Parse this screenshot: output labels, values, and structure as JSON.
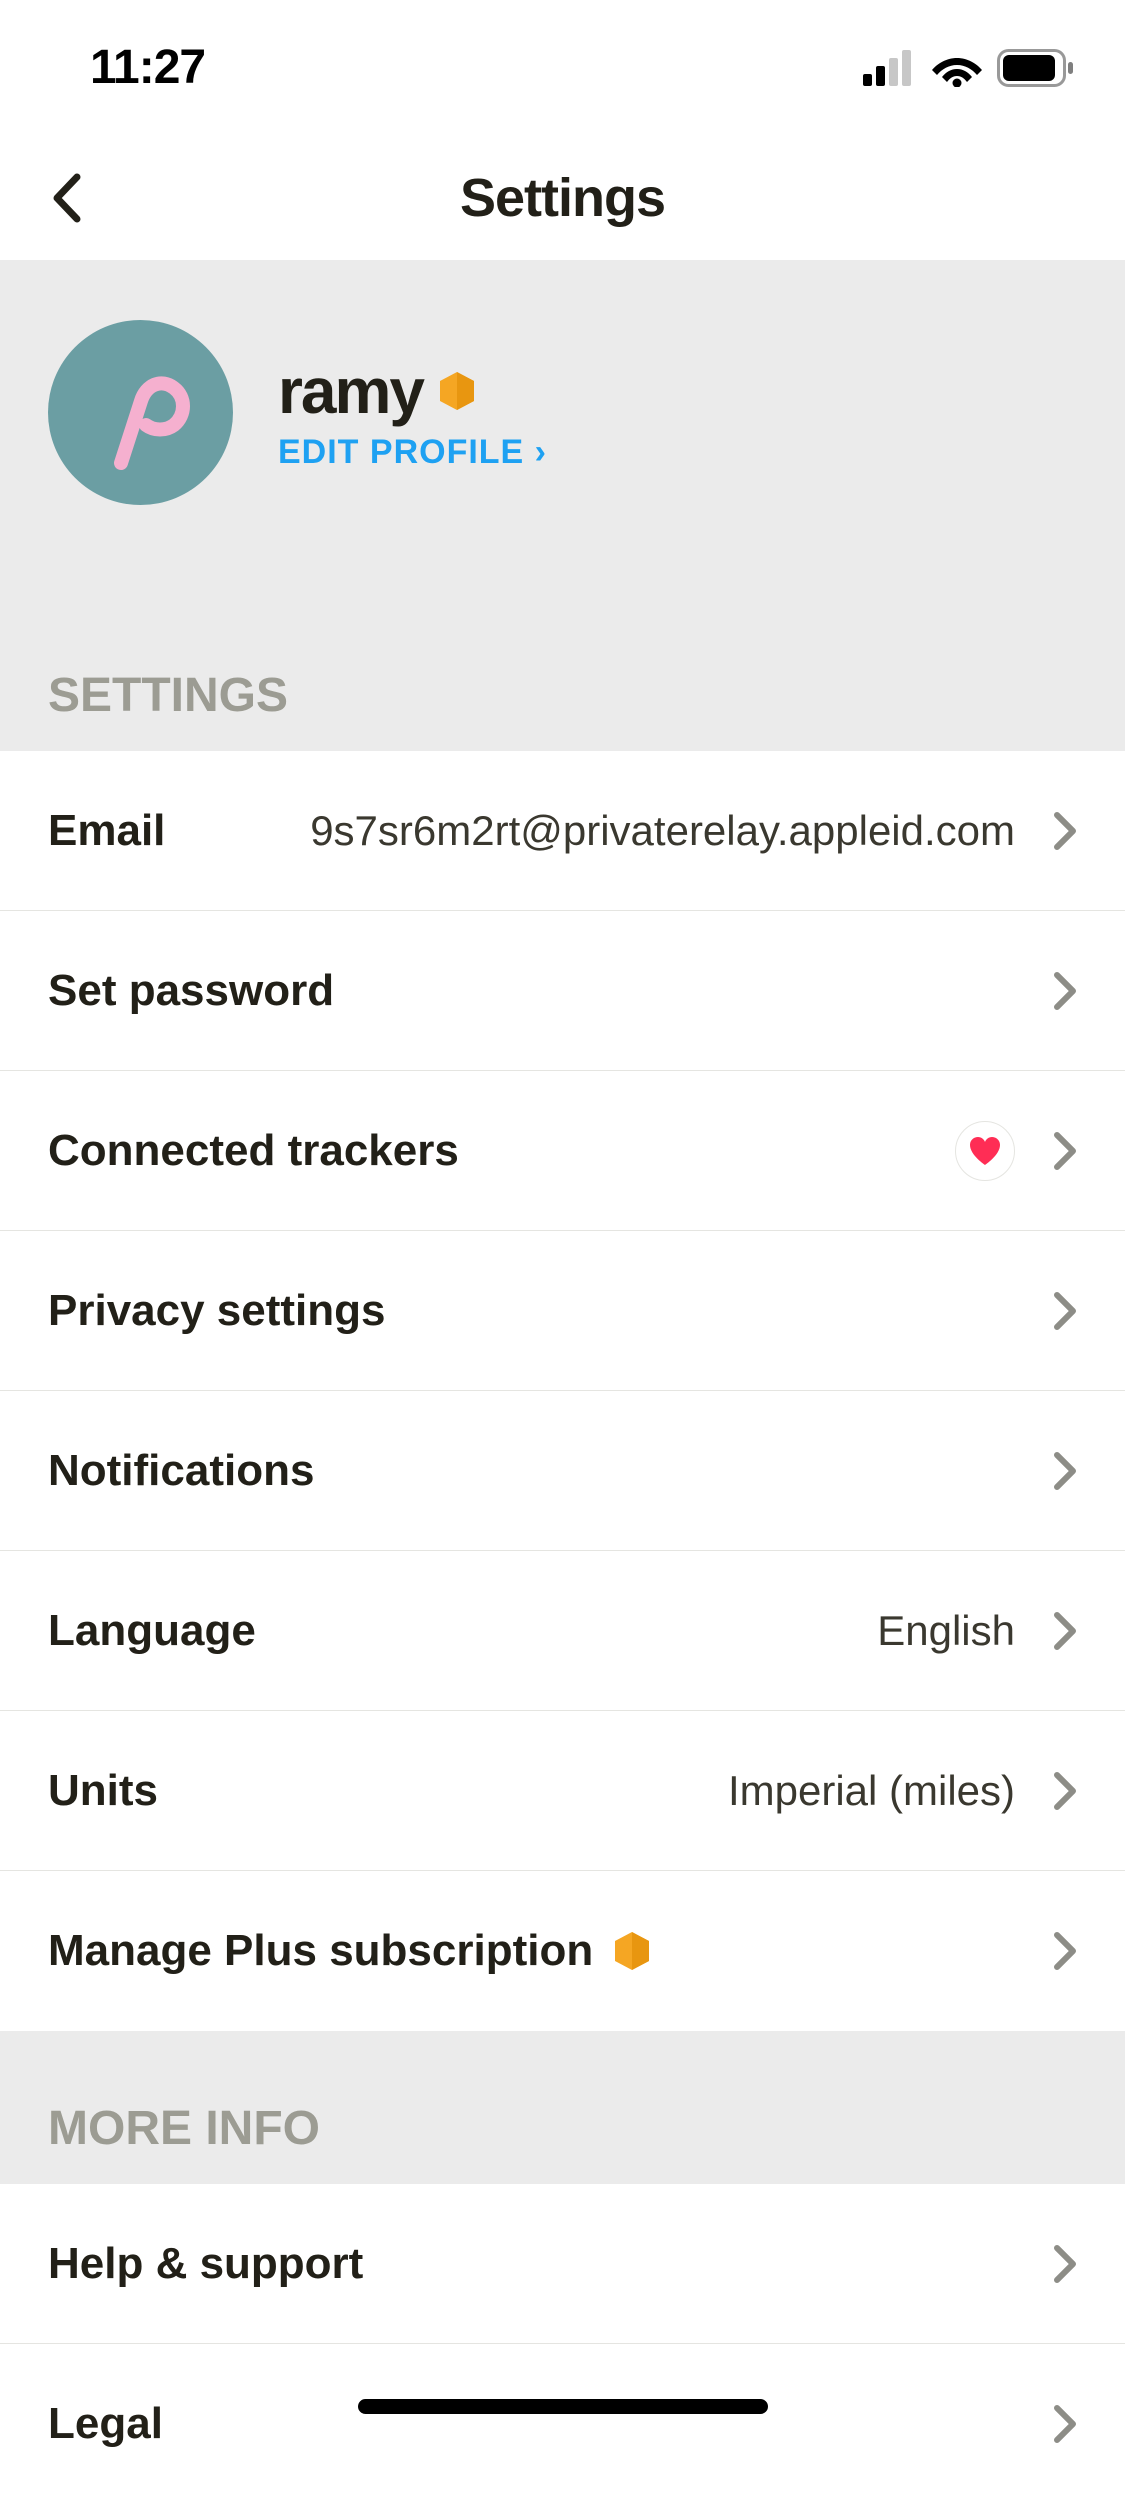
{
  "status": {
    "time": "11:27"
  },
  "header": {
    "title": "Settings"
  },
  "profile": {
    "name": "ramy",
    "edit_label": "EDIT PROFILE ›"
  },
  "sections": {
    "settings_header": "SETTINGS",
    "more_info_header": "MORE INFO"
  },
  "rows": {
    "email": {
      "label": "Email",
      "value": "9s7sr6m2rt@privaterelay.appleid.com"
    },
    "set_password": {
      "label": "Set password"
    },
    "connected_trackers": {
      "label": "Connected trackers"
    },
    "privacy": {
      "label": "Privacy settings"
    },
    "notifications": {
      "label": "Notifications"
    },
    "language": {
      "label": "Language",
      "value": "English"
    },
    "units": {
      "label": "Units",
      "value": "Imperial (miles)"
    },
    "manage_plus": {
      "label": "Manage Plus subscription"
    },
    "help": {
      "label": "Help & support"
    },
    "legal": {
      "label": "Legal"
    }
  }
}
